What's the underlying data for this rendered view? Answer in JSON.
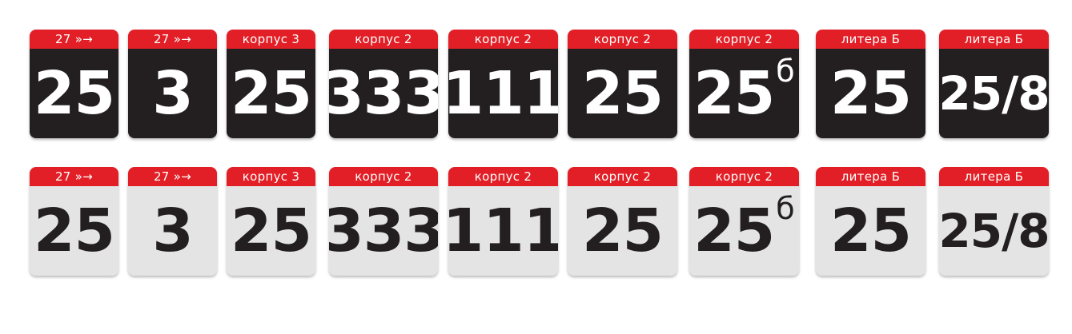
{
  "colors": {
    "header_red": "#e21f26",
    "dark_plate": "#231f20",
    "light_plate": "#e4e4e4"
  },
  "rows": [
    {
      "theme": "dark",
      "plates": [
        {
          "label": "27 »→",
          "number": "25",
          "suffix": ""
        },
        {
          "label": "27 »→",
          "number": "3",
          "suffix": ""
        },
        {
          "label": "корпус 3",
          "number": "25",
          "suffix": ""
        },
        {
          "label": "корпус 2",
          "number": "333",
          "suffix": ""
        },
        {
          "label": "корпус 2",
          "number": "111",
          "suffix": ""
        },
        {
          "label": "корпус 2",
          "number": "25",
          "suffix": ""
        },
        {
          "label": "корпус 2",
          "number": "25",
          "suffix": "б"
        },
        {
          "label": "литера Б",
          "number": "25",
          "suffix": ""
        },
        {
          "label": "литера Б",
          "number": "25/8",
          "suffix": ""
        }
      ]
    },
    {
      "theme": "light",
      "plates": [
        {
          "label": "27 »→",
          "number": "25",
          "suffix": ""
        },
        {
          "label": "27 »→",
          "number": "3",
          "suffix": ""
        },
        {
          "label": "корпус 3",
          "number": "25",
          "suffix": ""
        },
        {
          "label": "корпус 2",
          "number": "333",
          "suffix": ""
        },
        {
          "label": "корпус 2",
          "number": "111",
          "suffix": ""
        },
        {
          "label": "корпус 2",
          "number": "25",
          "suffix": ""
        },
        {
          "label": "корпус 2",
          "number": "25",
          "suffix": "б"
        },
        {
          "label": "литера Б",
          "number": "25",
          "suffix": ""
        },
        {
          "label": "литера Б",
          "number": "25/8",
          "suffix": ""
        }
      ]
    }
  ]
}
